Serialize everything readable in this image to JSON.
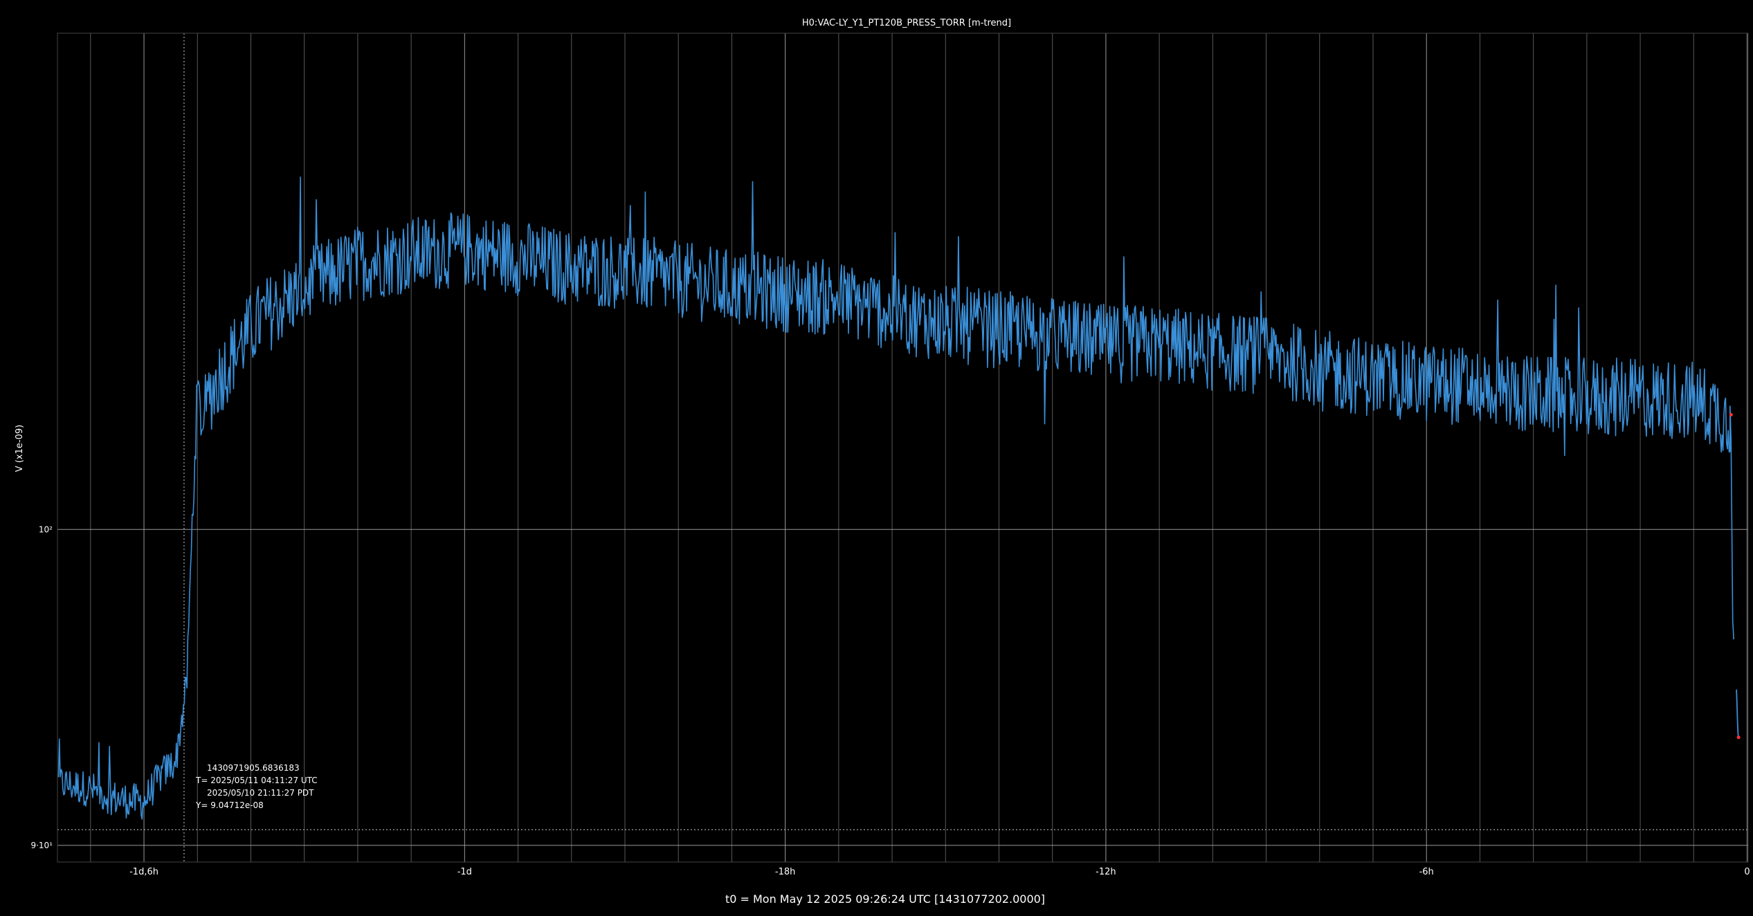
{
  "chart_data": {
    "type": "line",
    "title": "H0:VAC-LY_Y1_PT120B_PRESS_TORR [m-trend]",
    "ylabel": "V (x1e-09)",
    "xlabel": "t0 = Mon May 12 2025 09:26:24 UTC [1431077202.0000]",
    "y_scale": "log",
    "y_tick_labels": [
      {
        "value": 90,
        "label": "9·10¹"
      },
      {
        "value": 100,
        "label": "10²"
      }
    ],
    "x_unit": "hours relative to t0",
    "xlim": [
      -31.6,
      0
    ],
    "ylim": [
      89.5,
      118
    ],
    "x_ticks": [
      {
        "value": -30,
        "label": "-1d,6h"
      },
      {
        "value": -24,
        "label": "-1d"
      },
      {
        "value": -18,
        "label": "-18h"
      },
      {
        "value": -12,
        "label": "-12h"
      },
      {
        "value": -6,
        "label": "-6h"
      },
      {
        "value": 0,
        "label": "0"
      }
    ],
    "grid": true,
    "series": [
      {
        "color": "#3a8fd8",
        "description": "noisy minute trend; approximate envelope points",
        "x": [
          -31.6,
          -31.0,
          -30.5,
          -30.0,
          -29.7,
          -29.4,
          -29.2,
          -29.1,
          -29.0,
          -28.9,
          -28.8,
          -28.6,
          -28.2,
          -27.8,
          -27.0,
          -26.0,
          -25.0,
          -24.0,
          -23.0,
          -22.0,
          -21.0,
          -20.0,
          -19.0,
          -18.0,
          -17.0,
          -16.0,
          -15.0,
          -14.0,
          -13.0,
          -12.0,
          -11.0,
          -10.0,
          -9.0,
          -8.0,
          -7.0,
          -6.0,
          -5.0,
          -4.0,
          -3.0,
          -2.0,
          -1.0,
          -0.5,
          -0.3,
          -0.25,
          -0.2,
          -0.18,
          -0.16
        ],
        "y": [
          91.9,
          91.7,
          91.4,
          91.3,
          92.1,
          92.6,
          95.0,
          100.0,
          104.8,
          103.4,
          104.5,
          105.2,
          106.4,
          107.3,
          108.4,
          109.3,
          109.6,
          109.8,
          109.5,
          109.1,
          109.0,
          108.7,
          108.4,
          108.2,
          108.0,
          107.5,
          107.1,
          106.9,
          106.7,
          106.4,
          106.4,
          106.1,
          106.0,
          105.5,
          105.2,
          105.0,
          104.9,
          104.6,
          104.5,
          104.5,
          104.4,
          104.0,
          103.6,
          97.0,
          96.4,
          93.4,
          93.3
        ]
      }
    ],
    "cursor": {
      "x_hours": -29.25,
      "y": 90.47,
      "readout": [
        "1430971905.6836183",
        "T= 2025/05/11 04:11:27 UTC",
        "2025/05/10 21:11:27 PDT",
        "Y= 9.04712e-08"
      ]
    },
    "colors": {
      "background": "#000000",
      "grid": "#9a9a9a",
      "line": "#3a8fd8",
      "cursor": "#cccccc",
      "marker": "#ff3030"
    }
  }
}
